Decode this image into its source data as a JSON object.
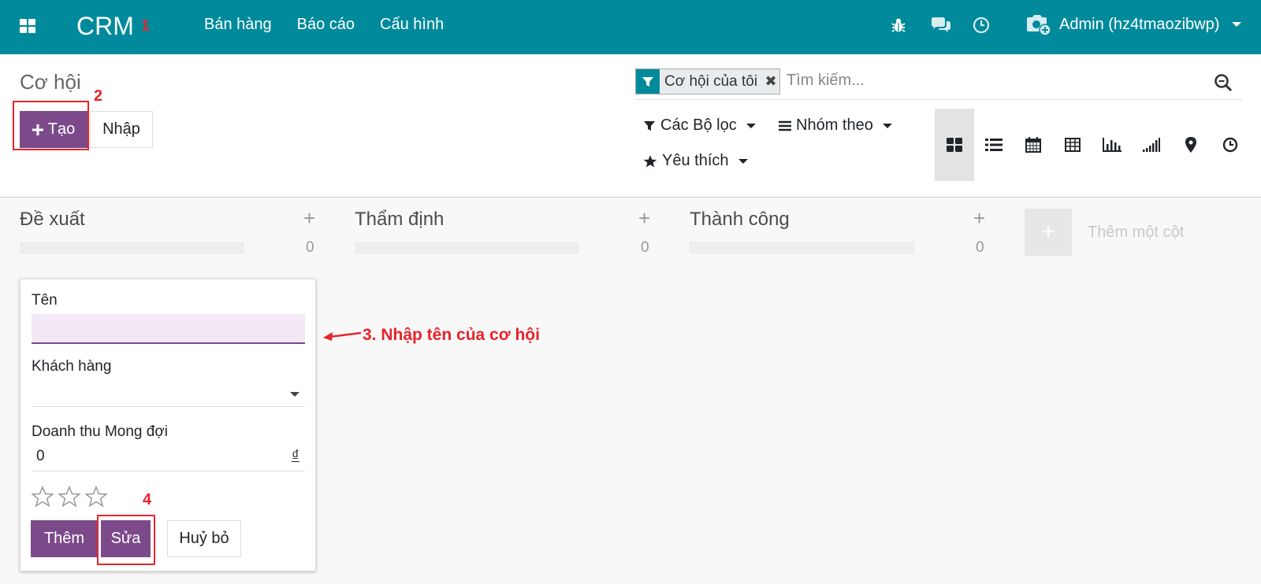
{
  "navbar": {
    "brand": "CRM",
    "menu": [
      "Bán hàng",
      "Báo cáo",
      "Cấu hình"
    ],
    "user": "Admin (hz4tmaozibwp)",
    "bg_color": "#018a9b"
  },
  "annotations": {
    "step1": "1",
    "step2": "2",
    "step3": "3. Nhập tên của cơ hội",
    "step4": "4",
    "color": "#e8232b"
  },
  "control_panel": {
    "breadcrumb": "Cơ hội",
    "create_label": "Tạo",
    "import_label": "Nhập",
    "search": {
      "facet": "Cơ hội của tôi",
      "placeholder": "Tìm kiếm..."
    },
    "filters_label": "Các Bộ lọc",
    "groupby_label": "Nhóm theo",
    "favorites_label": "Yêu thích",
    "views": [
      "kanban",
      "list",
      "calendar",
      "pivot",
      "graph",
      "cohort",
      "map",
      "activity"
    ],
    "active_view": "kanban"
  },
  "kanban": {
    "columns": [
      {
        "title": "Đề xuất",
        "count": "0"
      },
      {
        "title": "Thẩm định",
        "count": "0"
      },
      {
        "title": "Thành công",
        "count": "0"
      }
    ],
    "add_column_label": "Thêm một cột",
    "quick_create": {
      "name_label": "Tên",
      "name_value": "",
      "customer_label": "Khách hàng",
      "customer_value": "",
      "revenue_label": "Doanh thu Mong đợi",
      "revenue_value": "0",
      "currency": "₫",
      "priority_stars": 0,
      "add_label": "Thêm",
      "edit_label": "Sửa",
      "cancel_label": "Huỷ bỏ"
    }
  }
}
